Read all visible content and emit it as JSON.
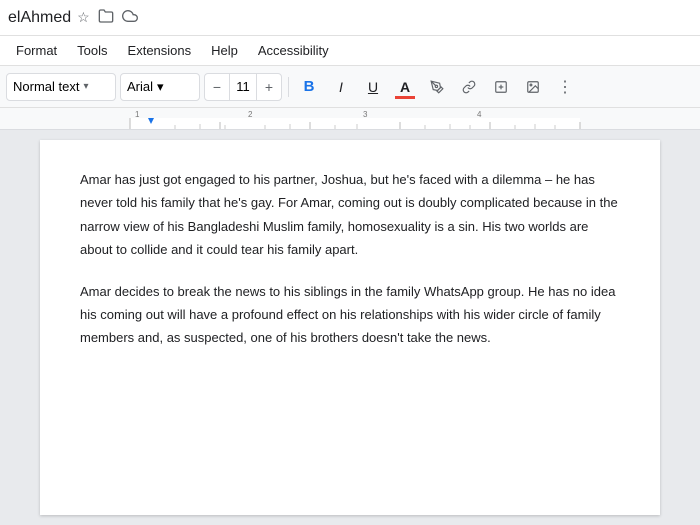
{
  "topbar": {
    "title": "elAhmed",
    "icons": [
      "star",
      "folder",
      "cloud"
    ]
  },
  "menubar": {
    "items": [
      "Format",
      "Tools",
      "Extensions",
      "Help",
      "Accessibility"
    ]
  },
  "toolbar": {
    "style_label": "Normal text",
    "font_label": "Arial",
    "font_size": "11",
    "minus_label": "−",
    "plus_label": "+",
    "bold_label": "B",
    "italic_label": "I",
    "underline_label": "U",
    "font_color_label": "A",
    "highlight_label": "✏",
    "link_label": "🔗",
    "insert_label": "⊞",
    "image_label": "⊟",
    "more_label": "⋮"
  },
  "document": {
    "paragraph1": "Amar has just got engaged to his partner, Joshua, but he's faced with a dilemma – he has never told his family that he's gay. For Amar, coming out is doubly complicated because in the narrow view of his Bangladeshi Muslim family, homosexuality is a sin. His two worlds are about to collide and it could tear his family apart.",
    "paragraph2": "Amar decides to break the news to his siblings in the family WhatsApp group. He has no idea his coming out will have a profound effect on his relationships with his wider circle of family members and, as suspected, one of his brothers doesn't take the news."
  }
}
